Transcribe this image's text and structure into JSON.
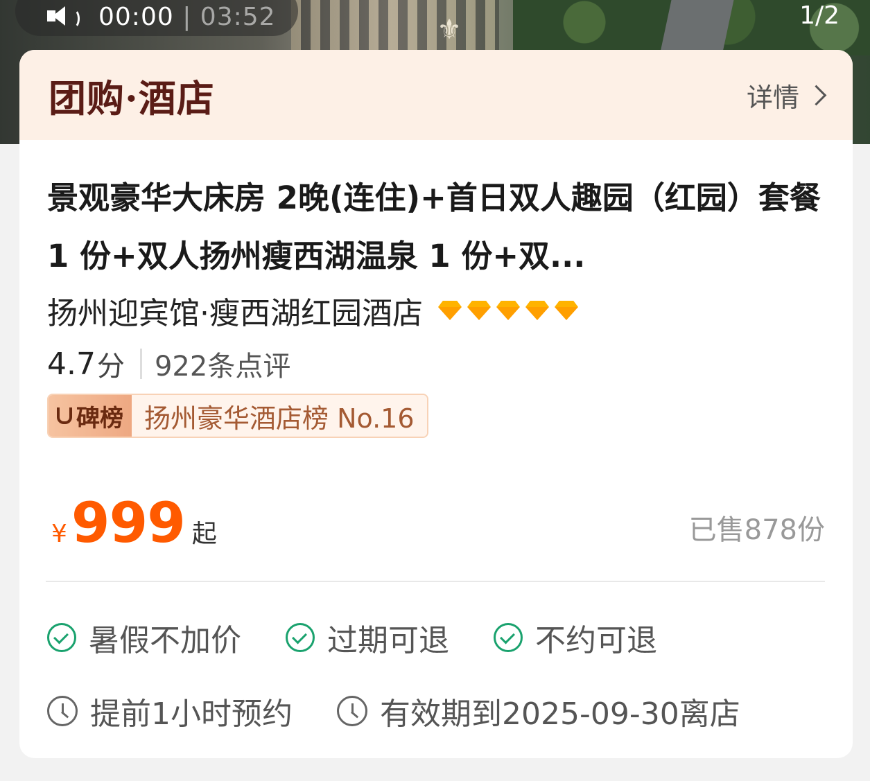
{
  "media": {
    "current_time": "00:00",
    "separator": "|",
    "total_time": "03:52",
    "pager": "1/2",
    "speaker_icon": "speaker-icon"
  },
  "header": {
    "brand": "团购·酒店",
    "details_label": "详情",
    "details_icon": "chevron-right-icon"
  },
  "product": {
    "title": "景观豪华大床房 2晚(连住)+首日双人趣园（红园）套餐 1 份+双人扬州瘦西湖温泉 1 份+双...",
    "hotel_name": "扬州迎宾馆·瘦西湖红园酒店",
    "diamond_count": 5,
    "score": "4.7",
    "score_unit": "分",
    "reviews": "922条点评",
    "rank_tag": "碑榜",
    "rank_text": "扬州豪华酒店榜 No.16"
  },
  "pricing": {
    "currency": "¥",
    "price": "999",
    "suffix": "起",
    "sold": "已售878份"
  },
  "features": [
    "暑假不加价",
    "过期可退",
    "不约可退"
  ],
  "infos": [
    "提前1小时预约",
    "有效期到2025-09-30离店"
  ],
  "colors": {
    "accent": "#ff5a00",
    "brand": "#5a1c16",
    "check": "#1aa26e",
    "header_bg": "#fdf0e6",
    "diamond": "#ffb300"
  }
}
